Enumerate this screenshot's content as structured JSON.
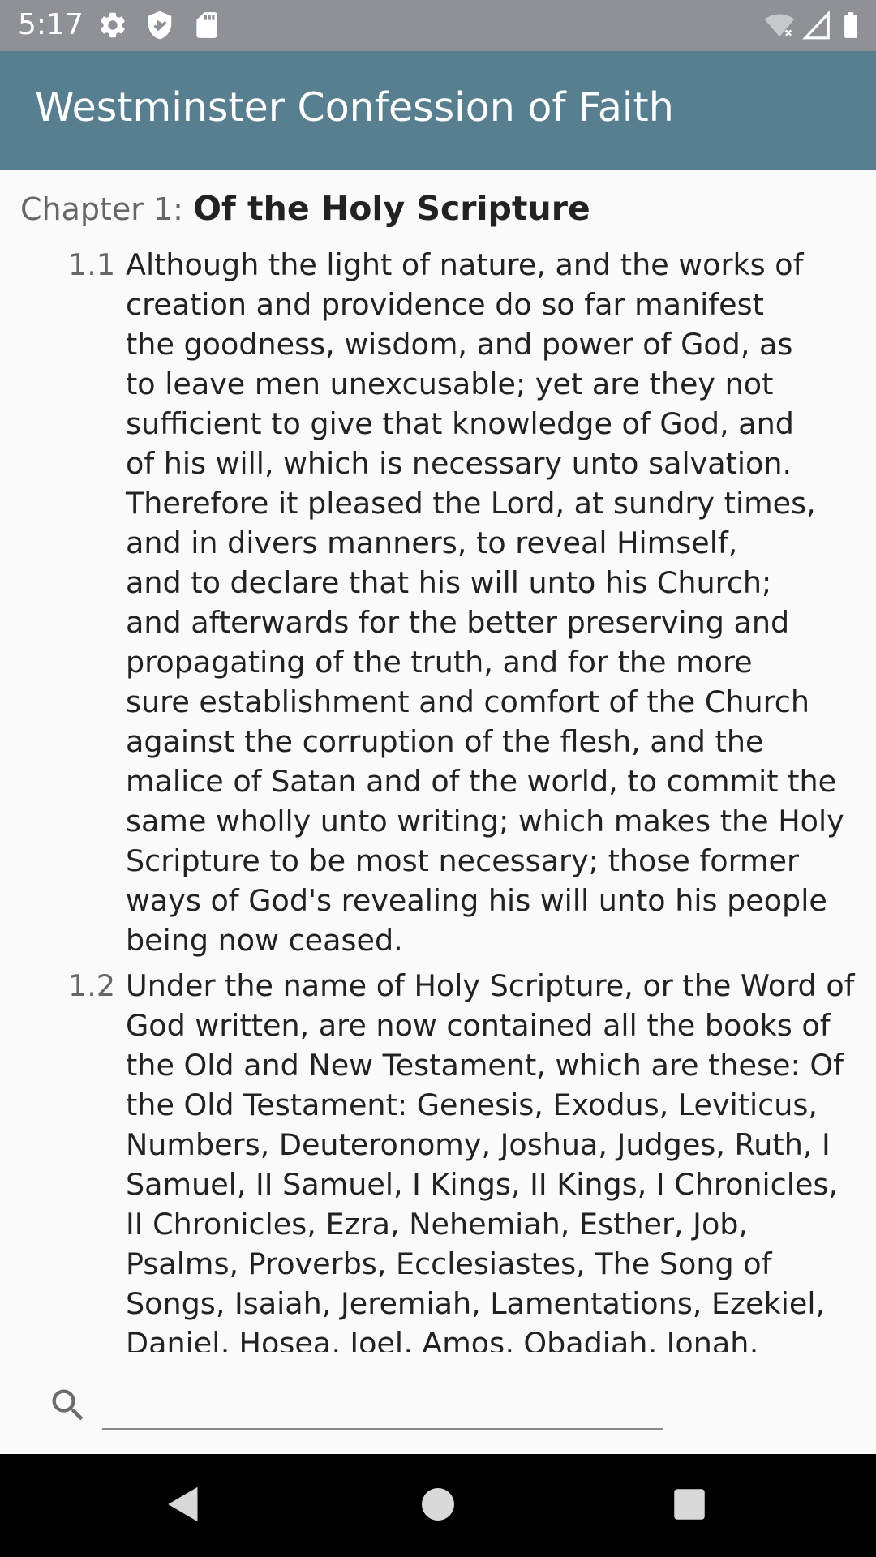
{
  "status_bar": {
    "time": "5:17",
    "left_icons": [
      "settings-icon",
      "shield-icon",
      "sd-card-icon"
    ],
    "right_icons": [
      "wifi-icon",
      "signal-icon",
      "battery-icon"
    ]
  },
  "app_bar": {
    "title": "Westminster Confession of Faith"
  },
  "chapter": {
    "prefix": "Chapter 1: ",
    "title": "Of the Holy Scripture"
  },
  "sections": [
    {
      "number": "1.1",
      "lines": [
        "Although the light of nature, and the works of",
        "creation and providence do so far manifest",
        "the goodness, wisdom, and power of God, as",
        "to leave men unexcusable; yet are they not",
        "sufficient to give that knowledge of God, and",
        "of his will, which is necessary unto salvation.",
        "Therefore it pleased the Lord, at sundry times,",
        "and in divers manners, to reveal Himself,",
        "and to declare that his will unto his Church;",
        "and afterwards for the better preserving and",
        "propagating of the truth, and for the more",
        "sure establishment and comfort of the Church",
        "against the corruption of the flesh, and the",
        "malice of Satan and of the world, to commit the",
        "same wholly unto writing; which makes the Holy",
        "Scripture to be most necessary; those former",
        "ways of God's revealing his will unto his people",
        "being now ceased."
      ]
    },
    {
      "number": "1.2",
      "lines": [
        "Under the name of Holy Scripture, or the Word of",
        "God written, are now contained all the books of",
        "the Old and New Testament, which are these: Of",
        "the Old Testament: Genesis, Exodus, Leviticus,",
        "Numbers, Deuteronomy, Joshua, Judges, Ruth, I",
        "Samuel, II Samuel, I Kings, II Kings, I Chronicles,",
        "II Chronicles, Ezra, Nehemiah, Esther, Job,",
        "Psalms, Proverbs, Ecclesiastes, The Song of",
        "Songs, Isaiah, Jeremiah, Lamentations, Ezekiel,",
        "Daniel, Hosea, Joel, Amos, Obadiah, Jonah,"
      ]
    }
  ],
  "search": {
    "icon": "search-icon",
    "value": "",
    "placeholder": ""
  },
  "nav_bar": {
    "buttons": [
      "back-icon",
      "home-icon",
      "recents-icon"
    ]
  },
  "colors": {
    "status_bar": "#8e9195",
    "app_bar": "#587f8f",
    "background": "#fafafa",
    "text": "#222222",
    "secondary_text": "#666666",
    "nav_bar": "#000000"
  }
}
